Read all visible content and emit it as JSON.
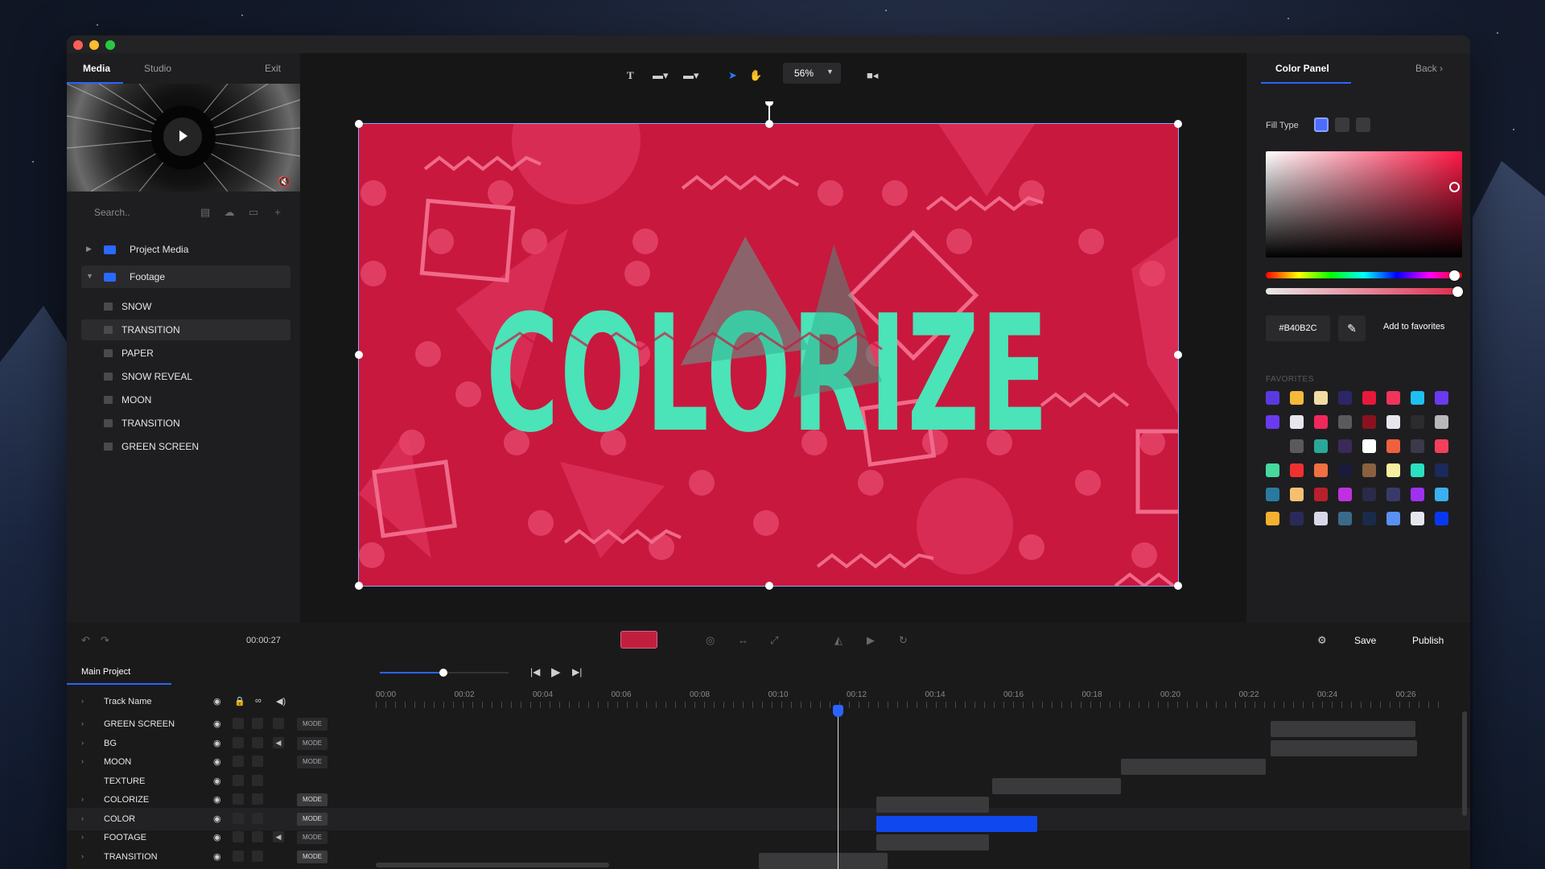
{
  "left_panel": {
    "tabs": [
      {
        "label": "Media"
      },
      {
        "label": "Studio"
      },
      {
        "label": "Exit"
      }
    ],
    "search_placeholder": "Search..",
    "tree": [
      {
        "label": "Project Media",
        "expanded": false
      },
      {
        "label": "Footage",
        "expanded": true
      }
    ],
    "footage_items": [
      "SNOW",
      "TRANSITION",
      "PAPER",
      "SNOW REVEAL",
      "MOON",
      "TRANSITION",
      "GREEN SCREEN"
    ],
    "selected_footage_item": "TRANSITION"
  },
  "toolbar": {
    "zoom": "56%"
  },
  "canvas": {
    "title_text": "COLORIZE",
    "background_color": "#C8183E",
    "text_color": "#4BE3B8"
  },
  "color_panel": {
    "title": "Color Panel",
    "back_label": "Back",
    "fill_type_label": "Fill Type",
    "hex_value": "#B40B2C",
    "add_favorites_label": "Add to favorites",
    "favorites_label": "FAVORITES",
    "favorites": [
      [
        "#5a3ae0",
        "#f6b93b",
        "#f3dca3",
        "#2b2666",
        "#e8183a",
        "#f0345c",
        "#1ec0f0",
        "#6a3af0"
      ],
      [
        "#6a3af0",
        "#e6e6ee",
        "#f0285c",
        "#5a5a5c",
        "#8a1220",
        "#e6e6ee",
        "#2c2c2e",
        "#b8b8bc"
      ],
      [
        "#1e1e20",
        "#5a5a5c",
        "#2aa898",
        "#3a2a5a",
        "#ffffff",
        "#f06040",
        "#3a3a4a",
        "#f0405c"
      ],
      [
        "#46d89c",
        "#f03030",
        "#f07040",
        "#1a1a3a",
        "#8a6040",
        "#f8f0a0",
        "#2ae0c0",
        "#1a2a5a"
      ],
      [
        "#2a7aa0",
        "#f6c070",
        "#b8202c",
        "#c030e0",
        "#2a2a4a",
        "#3a3a6a",
        "#a030f0",
        "#3ab0f0"
      ],
      [
        "#f6b030",
        "#2a2a5a",
        "#d8d8e8",
        "#3a6a8a",
        "#1a2a4a",
        "#5a90f0",
        "#e6e6ee",
        "#0a38f0"
      ]
    ]
  },
  "timeline": {
    "current_time": "00:00:27",
    "save_label": "Save",
    "publish_label": "Publish",
    "project_tab": "Main Project",
    "track_name_header": "Track Name",
    "ruler_labels": [
      "00:00",
      "00:02",
      "00:04",
      "00:06",
      "00:08",
      "00:10",
      "00:12",
      "00:14",
      "00:16",
      "00:18",
      "00:20",
      "00:22",
      "00:24",
      "00:26"
    ],
    "tracks": [
      {
        "name": "GREEN SCREEN",
        "mode": "MODE"
      },
      {
        "name": "BG",
        "mode": "MODE"
      },
      {
        "name": "MOON",
        "mode": "MODE"
      },
      {
        "name": "TEXTURE",
        "mode": ""
      },
      {
        "name": "COLORIZE",
        "mode": "MODE"
      },
      {
        "name": "COLOR",
        "mode": "MODE"
      },
      {
        "name": "FOOTAGE",
        "mode": "MODE"
      },
      {
        "name": "TRANSITION",
        "mode": "MODE"
      }
    ],
    "playhead_time": "00:11.5"
  },
  "icons": {
    "text_tool": "text-icon",
    "shape_tool": "rectangle-icon",
    "image_tool": "image-icon",
    "select_tool": "pointer-icon",
    "hand_tool": "hand-icon",
    "record": "camera-icon",
    "settings": "gear-icon"
  }
}
